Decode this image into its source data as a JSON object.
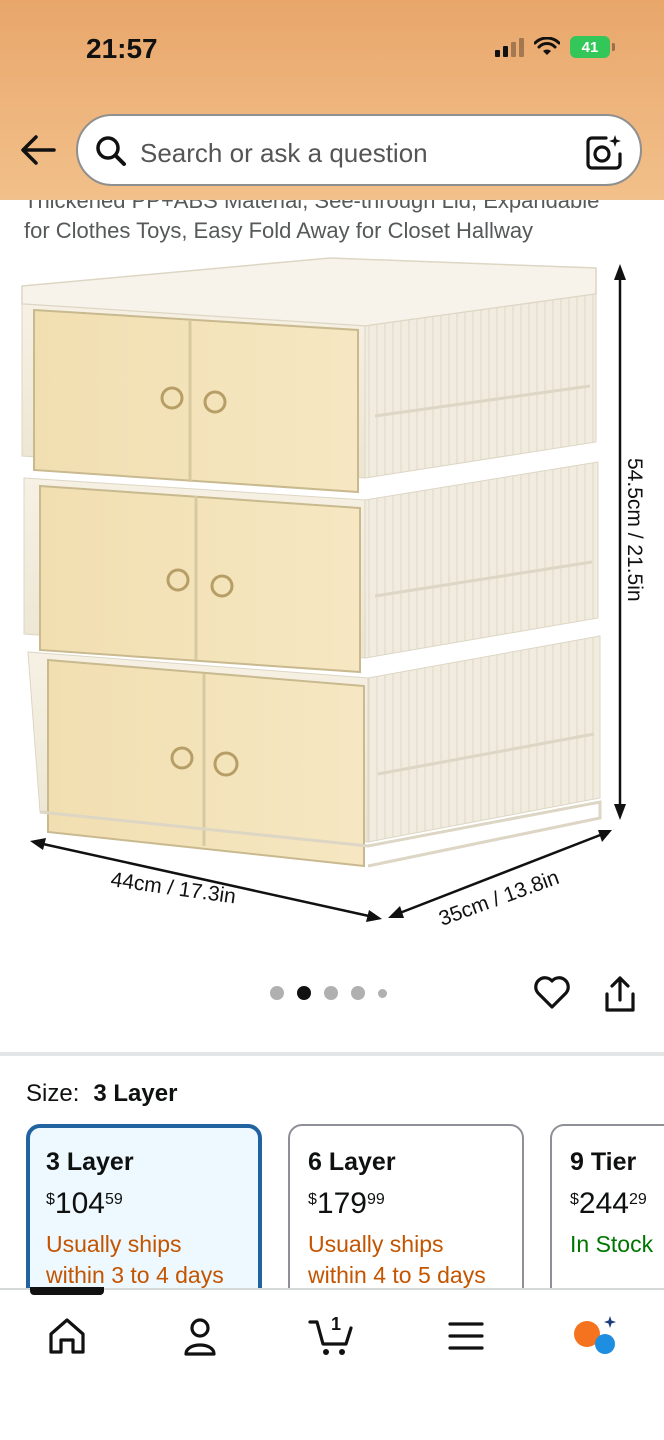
{
  "status_bar": {
    "time": "21:57",
    "battery": "41"
  },
  "search": {
    "placeholder": "Search or ask a question"
  },
  "product": {
    "title_line1": "Thickened PP+ABS Material, See-through Lid, Expandable",
    "title_line2": "for Clothes Toys, Easy Fold Away for Closet Hallway",
    "image_labels": {
      "height": "54.5cm / 21.5in",
      "width": "44cm / 17.3in",
      "depth": "35cm / 13.8in"
    },
    "image_count": 5,
    "active_image_index": 1
  },
  "size": {
    "label": "Size:",
    "selected": "3 Layer",
    "options": [
      {
        "name": "3 Layer",
        "currency": "$",
        "price_whole": "104",
        "price_fraction": "59",
        "ship_line1": "Usually ships",
        "ship_line2": "within 3 to 4 days",
        "status_color": "#c45500",
        "selected": true
      },
      {
        "name": "6 Layer",
        "currency": "$",
        "price_whole": "179",
        "price_fraction": "99",
        "ship_line1": "Usually ships",
        "ship_line2": "within 4 to 5 days",
        "status_color": "#c45500",
        "selected": false
      },
      {
        "name": "9 Tier",
        "currency": "$",
        "price_whole": "244",
        "price_fraction": "29",
        "ship_line1": "In Stock",
        "ship_line2": "",
        "status_color": "#007600",
        "selected": false
      }
    ]
  },
  "bottom_nav": {
    "items": [
      "home-icon",
      "account-icon",
      "cart-icon",
      "menu-icon",
      "rufus-icon"
    ],
    "cart_count": "1"
  },
  "colors": {
    "header": "#eeb57d",
    "selected_border": "#2162a1",
    "ship_orange": "#c45500",
    "in_stock_green": "#007600"
  }
}
